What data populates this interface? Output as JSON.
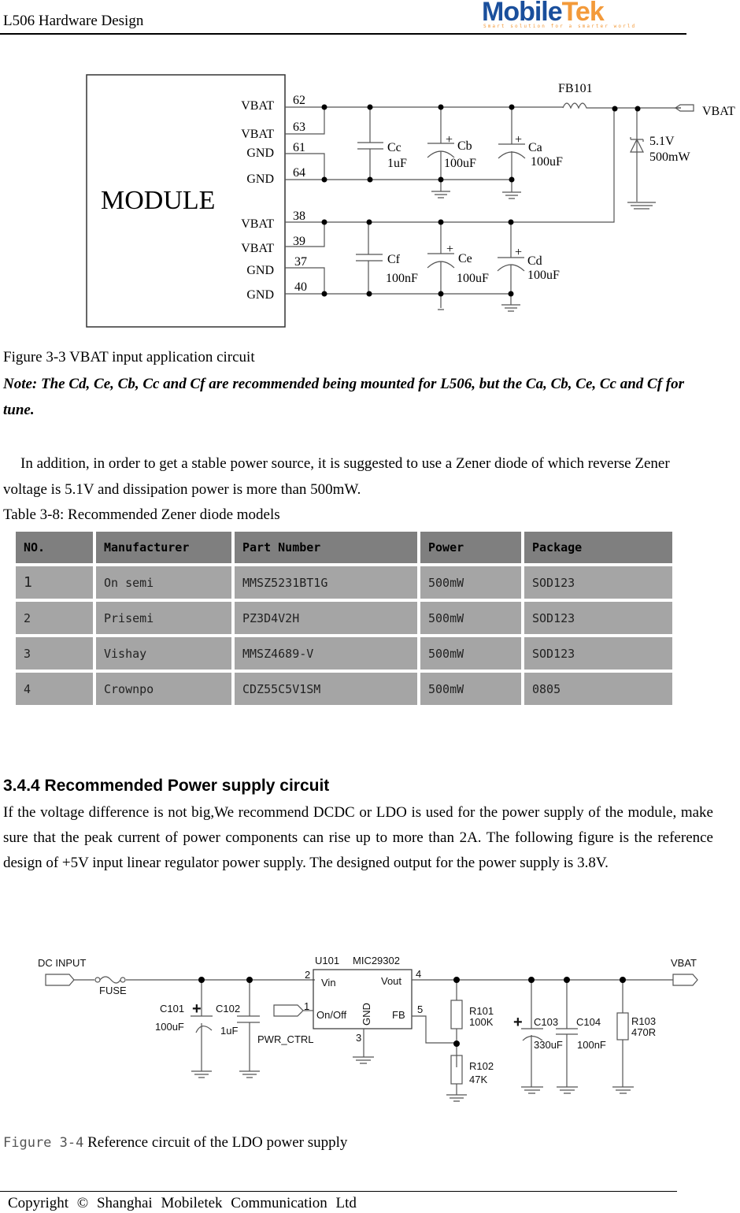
{
  "header": {
    "title": "L506 Hardware Design",
    "logo": {
      "brand_blue": "Mobile",
      "brand_orange": "Tek",
      "tagline": "Smart solution for a smarter world",
      "blue": "#1a4f9c",
      "orange": "#f39a3a"
    }
  },
  "figure_3_3": {
    "module_label": "MODULE",
    "pins": [
      {
        "name": "VBAT",
        "num": "62"
      },
      {
        "name": "VBAT",
        "num": "63"
      },
      {
        "name": "GND",
        "num": "61"
      },
      {
        "name": "GND",
        "num": "64"
      },
      {
        "name": "VBAT",
        "num": "38"
      },
      {
        "name": "VBAT",
        "num": "39"
      },
      {
        "name": "GND",
        "num": "37"
      },
      {
        "name": "GND",
        "num": "40"
      }
    ],
    "components": {
      "cc": {
        "ref": "Cc",
        "value": "1uF"
      },
      "cb": {
        "ref": "Cb",
        "value": "100uF"
      },
      "ca": {
        "ref": "Ca",
        "value": "100uF"
      },
      "cf": {
        "ref": "Cf",
        "value": "100nF"
      },
      "ce": {
        "ref": "Ce",
        "value": "100uF"
      },
      "cd": {
        "ref": "Cd",
        "value": "100uF"
      },
      "fb": {
        "ref": "FB101"
      },
      "zener": {
        "voltage": "5.1V",
        "power": "500mW"
      },
      "port": "VBAT",
      "plus": "+"
    },
    "caption": "Figure 3-3 VBAT input application circuit"
  },
  "note": "Note: The Cd, Ce, Cb, Cc and Cf are recommended being mounted for L506, but the Ca, Cb, Ce, Cc and Cf for tune.",
  "paragraph1": "In addition, in order to get a stable power source, it is suggested to use a Zener diode of which reverse Zener voltage is 5.1V and dissipation power is more than 500mW.",
  "table": {
    "caption": "Table 3-8: Recommended Zener diode models",
    "headers": [
      "NO.",
      "Manufacturer",
      "Part Number",
      "Power",
      "Package"
    ],
    "rows": [
      [
        "1",
        "On semi",
        "MMSZ5231BT1G",
        "500mW",
        "SOD123"
      ],
      [
        "2",
        "Prisemi",
        "PZ3D4V2H",
        "500mW",
        "SOD123"
      ],
      [
        "3",
        "Vishay",
        "MMSZ4689-V",
        "500mW",
        "SOD123"
      ],
      [
        "4",
        "Crownpo",
        "CDZ55C5V1SM",
        "500mW",
        "0805"
      ]
    ]
  },
  "section": {
    "heading": "3.4.4 Recommended Power supply circuit",
    "body": "If the voltage difference is not big,We recommend DCDC or LDO is used for the power supply of the module, make sure that the peak current of power components can rise up to more than 2A. The following figure is the reference design of +5V input linear regulator power supply. The designed output for the power supply is 3.8V."
  },
  "figure_3_4": {
    "dc_input": "DC INPUT",
    "fuse": "FUSE",
    "c101": {
      "ref": "C101",
      "value": "100uF"
    },
    "c102": {
      "ref": "C102",
      "value": "1uF"
    },
    "pwr_ctrl": "PWR_CTRL",
    "u101": {
      "ref": "U101",
      "part": "MIC29302",
      "vin": "Vin",
      "vout": "Vout",
      "onoff": "On/Off",
      "gnd": "GND",
      "fb": "FB",
      "pin1": "1",
      "pin2": "2",
      "pin3": "3",
      "pin4": "4",
      "pin5": "5"
    },
    "r101": {
      "ref": "R101",
      "value": "100K"
    },
    "r102": {
      "ref": "R102",
      "value": "47K"
    },
    "c103": {
      "ref": "C103",
      "value": "330uF"
    },
    "c104": {
      "ref": "C104",
      "value": "100nF"
    },
    "r103": {
      "ref": "R103",
      "value": "470R"
    },
    "vbat": "VBAT",
    "plus": "+",
    "caption_prefix": "Figure 3-4",
    "caption": " Reference circuit of the LDO power supply"
  },
  "footer": {
    "copyright": "Copyright © Shanghai Mobiletek Communication Ltd"
  }
}
